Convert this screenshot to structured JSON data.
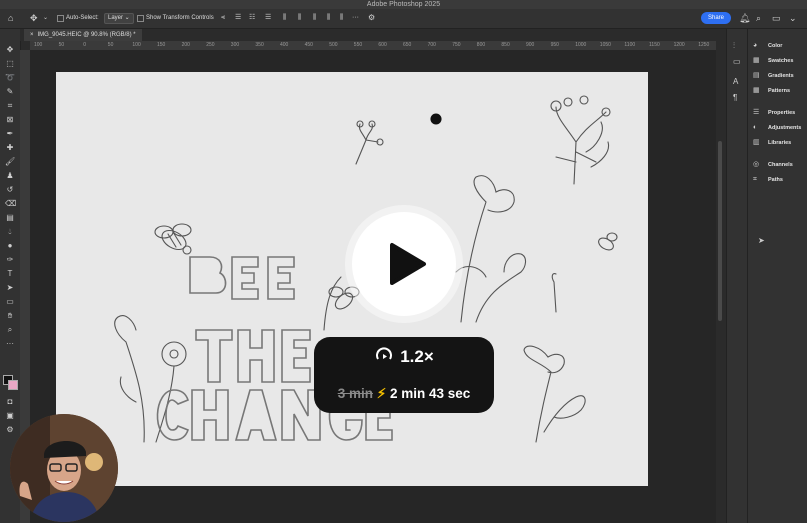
{
  "app": {
    "window_title": "Adobe Photoshop 2025"
  },
  "options_bar": {
    "auto_select_label": "Auto-Select:",
    "auto_select_value": "Layer",
    "transform_label": "Show Transform Controls",
    "share_label": "Share"
  },
  "document_tab": {
    "title": "IMG_9045.HEIC @ 90.8% (RGB/8) *"
  },
  "ruler_ticks": [
    "100",
    "50",
    "0",
    "50",
    "100",
    "150",
    "200",
    "250",
    "300",
    "350",
    "400",
    "450",
    "500",
    "550",
    "600",
    "650",
    "700",
    "750",
    "800",
    "850",
    "900",
    "950",
    "1000",
    "1050",
    "1100",
    "1150",
    "1200",
    "1250",
    "1300"
  ],
  "right_panel": {
    "items": [
      {
        "label": "Color",
        "icon": "color-wheel-icon"
      },
      {
        "label": "Swatches",
        "icon": "swatches-grid-icon"
      },
      {
        "label": "Gradients",
        "icon": "gradient-icon"
      },
      {
        "label": "Patterns",
        "icon": "patterns-grid-icon"
      },
      {
        "label": "Properties",
        "icon": "sliders-icon"
      },
      {
        "label": "Adjustments",
        "icon": "adjust-circle-icon"
      },
      {
        "label": "Libraries",
        "icon": "libraries-icon"
      },
      {
        "label": "Channels",
        "icon": "channels-icon"
      },
      {
        "label": "Paths",
        "icon": "paths-icon"
      }
    ]
  },
  "artwork": {
    "word_1": "BEE",
    "word_2": "THE",
    "word_3": "CHANGE"
  },
  "video_overlay": {
    "speed_label": "1.2×",
    "original_time": "3 min",
    "fast_time": "2 min 43 sec",
    "play_icon": "play-icon",
    "speed_icon": "playback-speed-icon",
    "bolt_icon": "lightning-bolt-icon"
  },
  "colors": {
    "accent_share": "#2e6ff2",
    "canvas": "#e8e8e8",
    "overlay_pill": "#141414",
    "bolt": "#f5c000"
  }
}
